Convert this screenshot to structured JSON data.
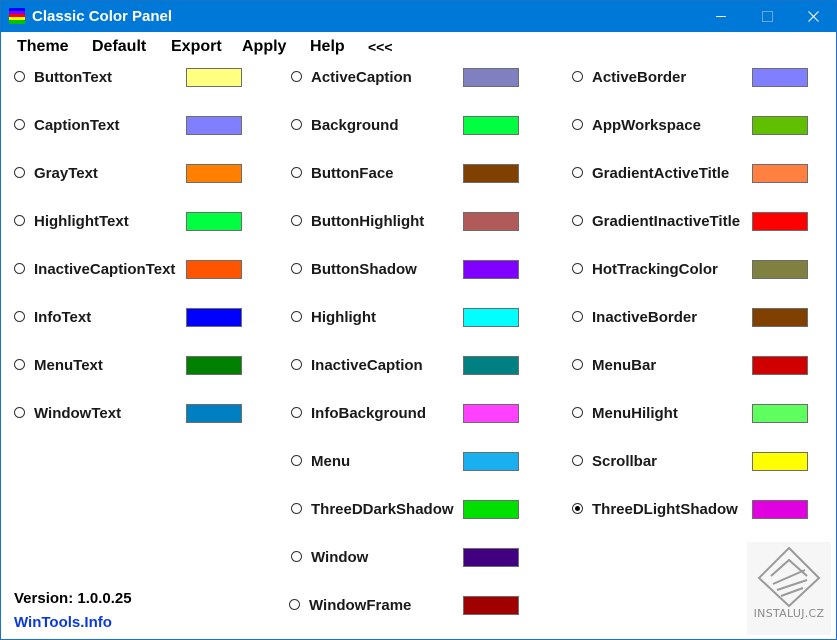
{
  "window": {
    "title": "Classic Color Panel"
  },
  "menu": [
    {
      "label": "Theme"
    },
    {
      "label": "Default"
    },
    {
      "label": "Export"
    },
    {
      "label": "Apply"
    },
    {
      "label": "Help"
    },
    {
      "label": "<<<"
    }
  ],
  "columns": [
    {
      "items": [
        {
          "name": "ButtonText",
          "color": "#ffff80",
          "selected": false
        },
        {
          "name": "CaptionText",
          "color": "#8080ff",
          "selected": false
        },
        {
          "name": "GrayText",
          "color": "#ff8000",
          "selected": false
        },
        {
          "name": "HighlightText",
          "color": "#00ff40",
          "selected": false
        },
        {
          "name": "InactiveCaptionText",
          "color": "#ff5500",
          "selected": false
        },
        {
          "name": "InfoText",
          "color": "#0000ff",
          "selected": false
        },
        {
          "name": "MenuText",
          "color": "#008000",
          "selected": false
        },
        {
          "name": "WindowText",
          "color": "#0080c0",
          "selected": false
        }
      ]
    },
    {
      "items": [
        {
          "name": "ActiveCaption",
          "color": "#8080c0",
          "selected": false
        },
        {
          "name": "Background",
          "color": "#00ff40",
          "selected": false
        },
        {
          "name": "ButtonFace",
          "color": "#804000",
          "selected": false
        },
        {
          "name": "ButtonHighlight",
          "color": "#b05a5a",
          "selected": false
        },
        {
          "name": "ButtonShadow",
          "color": "#8000ff",
          "selected": false
        },
        {
          "name": "Highlight",
          "color": "#00ffff",
          "selected": false
        },
        {
          "name": "InactiveCaption",
          "color": "#008080",
          "selected": false
        },
        {
          "name": "InfoBackground",
          "color": "#ff40ff",
          "selected": false
        },
        {
          "name": "Menu",
          "color": "#1ab0f0",
          "selected": false
        },
        {
          "name": "ThreeDDarkShadow",
          "color": "#00e000",
          "selected": false
        },
        {
          "name": "Window",
          "color": "#400080",
          "selected": false
        },
        {
          "name": "WindowFrame",
          "color": "#a00000",
          "selected": false
        }
      ]
    },
    {
      "items": [
        {
          "name": "ActiveBorder",
          "color": "#8080ff",
          "selected": false
        },
        {
          "name": "AppWorkspace",
          "color": "#60c000",
          "selected": false
        },
        {
          "name": "GradientActiveTitle",
          "color": "#ff8040",
          "selected": false
        },
        {
          "name": "GradientInactiveTitle",
          "color": "#ff0000",
          "selected": false
        },
        {
          "name": "HotTrackingColor",
          "color": "#808040",
          "selected": false
        },
        {
          "name": "InactiveBorder",
          "color": "#804000",
          "selected": false
        },
        {
          "name": "MenuBar",
          "color": "#d00000",
          "selected": false
        },
        {
          "name": "MenuHilight",
          "color": "#60ff60",
          "selected": false
        },
        {
          "name": "Scrollbar",
          "color": "#ffff00",
          "selected": false
        },
        {
          "name": "ThreeDLightShadow",
          "color": "#e000e0",
          "selected": true
        }
      ]
    }
  ],
  "footer": {
    "version": "Version: 1.0.0.25",
    "website": "WinTools.Info"
  },
  "watermark": {
    "text": "INSTALUJ.CZ"
  }
}
